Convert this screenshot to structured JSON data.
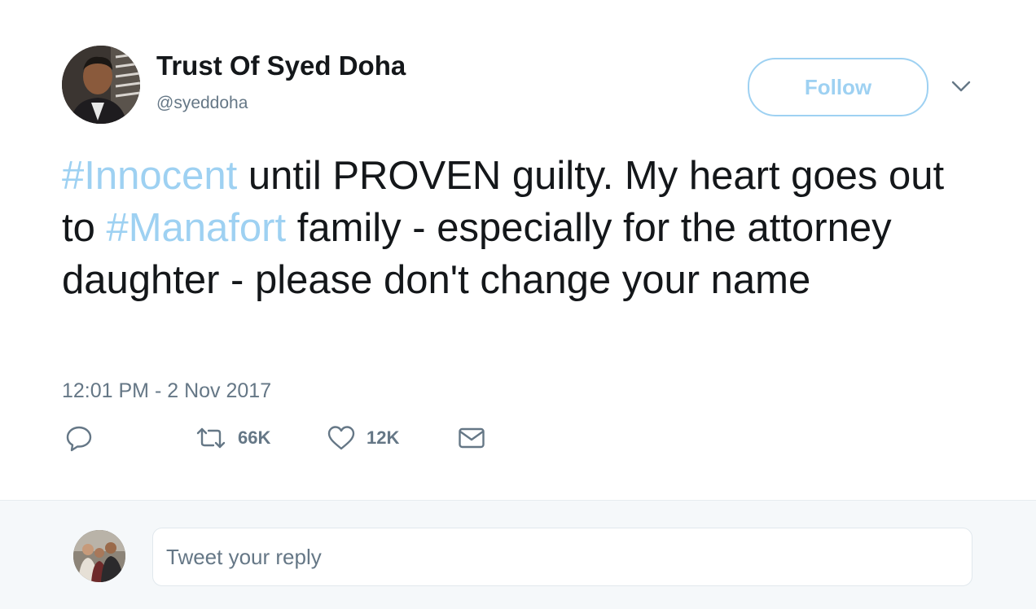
{
  "user": {
    "display_name": "Trust Of Syed Doha",
    "handle": "@syeddoha"
  },
  "header": {
    "follow_label": "Follow",
    "menu_icon": "chevron-down-icon"
  },
  "tweet": {
    "hashtag1": "#Innocent",
    "text1": " until PROVEN guilty. My heart goes out to ",
    "hashtag2": "#Manafort",
    "text2": " family - especially for the attorney daughter - please don't change your name",
    "timestamp": "12:01 PM - 2 Nov 2017"
  },
  "actions": {
    "reply_icon": "reply-icon",
    "retweet_icon": "retweet-icon",
    "retweet_count": "66K",
    "like_icon": "heart-icon",
    "like_count": "12K",
    "dm_icon": "envelope-icon"
  },
  "reply": {
    "placeholder": "Tweet your reply"
  },
  "colors": {
    "accent_light": "#9ed1f2",
    "text_primary": "#14171a",
    "text_secondary": "#657786",
    "reply_bar_bg": "#f5f8fa"
  }
}
